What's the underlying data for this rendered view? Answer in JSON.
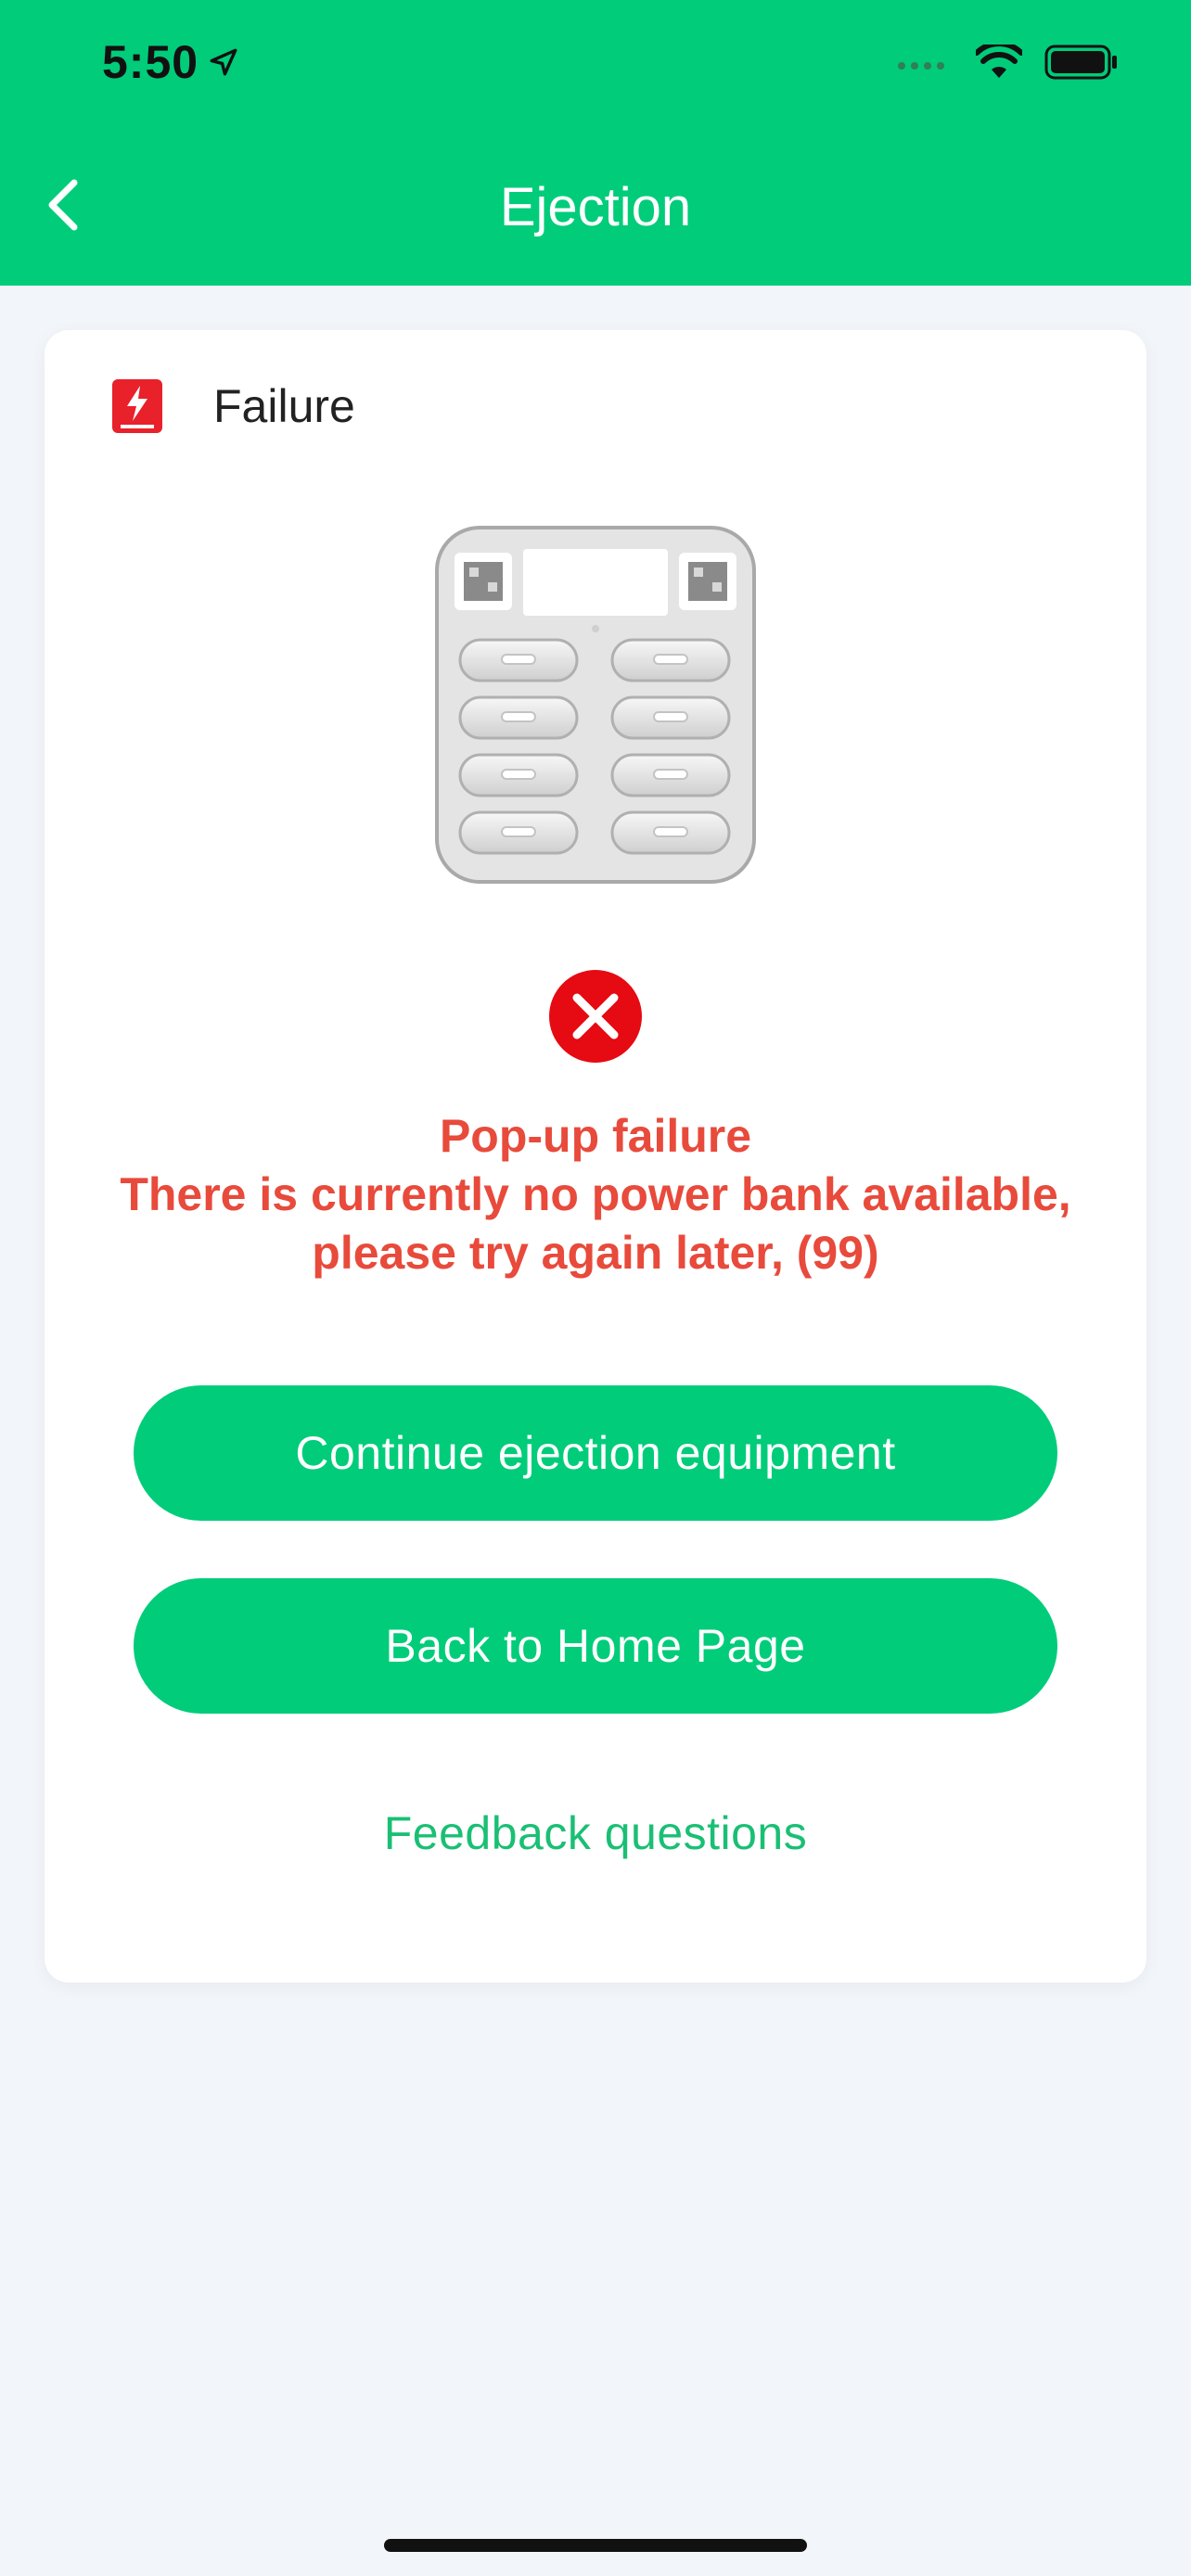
{
  "status_bar": {
    "time": "5:50"
  },
  "header": {
    "title": "Ejection",
    "accent_color": "#00cc7a"
  },
  "card": {
    "status_label": "Failure",
    "error": {
      "title": "Pop-up failure",
      "line1": "There is currently no power bank available,",
      "line2": "please try again later, (99)",
      "color": "#e84a3b"
    },
    "buttons": {
      "continue_label": "Continue ejection equipment",
      "home_label": "Back to Home Page"
    },
    "feedback_link": "Feedback questions"
  },
  "icons": {
    "back": "chevron-left-icon",
    "status": "power-bank-icon",
    "error": "close-circle-icon",
    "location": "location-arrow-icon",
    "wifi": "wifi-icon",
    "battery": "battery-icon",
    "signal": "signal-icon"
  }
}
